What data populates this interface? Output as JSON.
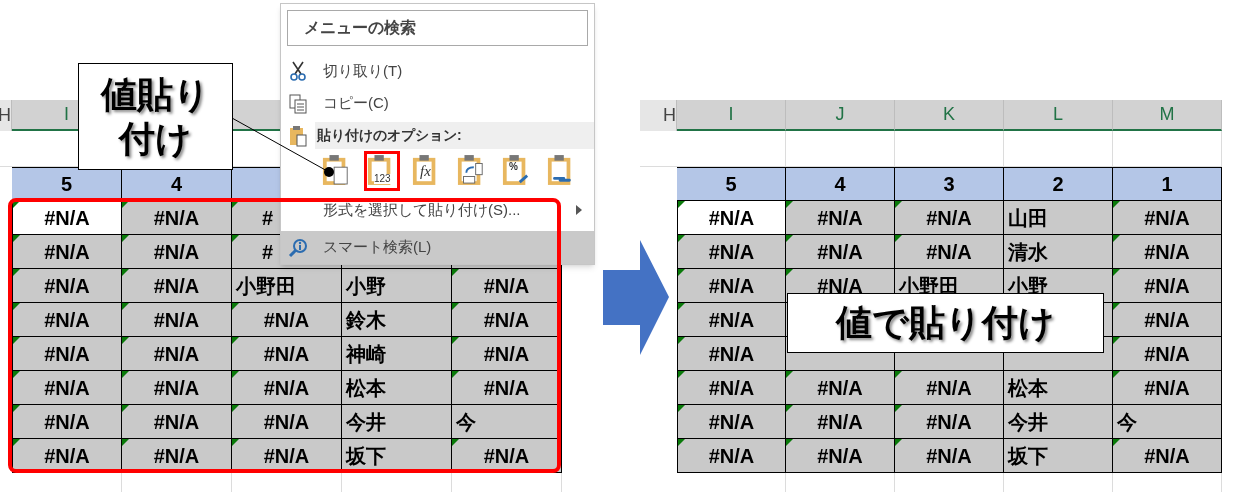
{
  "left_sheet": {
    "row_stub": "H",
    "columns": [
      "I"
    ],
    "numbers": [
      "5",
      "4"
    ],
    "rows": [
      [
        {
          "kind": "error",
          "text": "#N/A",
          "selected": true
        },
        {
          "kind": "error",
          "text": "#N/A",
          "selected": false
        },
        {
          "kind": "clipped",
          "text": "#",
          "selected": false
        }
      ],
      [
        {
          "kind": "error",
          "text": "#N/A",
          "selected": false
        },
        {
          "kind": "error",
          "text": "#N/A",
          "selected": false
        },
        {
          "kind": "clipped",
          "text": "#",
          "selected": false
        }
      ],
      [
        {
          "kind": "error",
          "text": "#N/A",
          "selected": false
        },
        {
          "kind": "error",
          "text": "#N/A",
          "selected": false
        },
        {
          "kind": "name",
          "text": "小野田",
          "selected": false
        },
        {
          "kind": "name",
          "text": "小野",
          "selected": false
        },
        {
          "kind": "error",
          "text": "#N/A",
          "selected": false
        }
      ],
      [
        {
          "kind": "error",
          "text": "#N/A",
          "selected": false
        },
        {
          "kind": "error",
          "text": "#N/A",
          "selected": false
        },
        {
          "kind": "error",
          "text": "#N/A",
          "selected": false
        },
        {
          "kind": "name",
          "text": "鈴木",
          "selected": false
        },
        {
          "kind": "error",
          "text": "#N/A",
          "selected": false
        }
      ],
      [
        {
          "kind": "error",
          "text": "#N/A",
          "selected": false
        },
        {
          "kind": "error",
          "text": "#N/A",
          "selected": false
        },
        {
          "kind": "error",
          "text": "#N/A",
          "selected": false
        },
        {
          "kind": "name",
          "text": "神崎",
          "selected": false
        },
        {
          "kind": "error",
          "text": "#N/A",
          "selected": false
        }
      ],
      [
        {
          "kind": "error",
          "text": "#N/A",
          "selected": false
        },
        {
          "kind": "error",
          "text": "#N/A",
          "selected": false
        },
        {
          "kind": "error",
          "text": "#N/A",
          "selected": false
        },
        {
          "kind": "name",
          "text": "松本",
          "selected": false
        },
        {
          "kind": "error",
          "text": "#N/A",
          "selected": false
        }
      ],
      [
        {
          "kind": "error",
          "text": "#N/A",
          "selected": false
        },
        {
          "kind": "error",
          "text": "#N/A",
          "selected": false
        },
        {
          "kind": "error",
          "text": "#N/A",
          "selected": false
        },
        {
          "kind": "name",
          "text": "今井",
          "selected": false
        },
        {
          "kind": "name",
          "text": "今",
          "selected": false
        }
      ],
      [
        {
          "kind": "error",
          "text": "#N/A",
          "selected": false
        },
        {
          "kind": "error",
          "text": "#N/A",
          "selected": false
        },
        {
          "kind": "error",
          "text": "#N/A",
          "selected": false
        },
        {
          "kind": "name",
          "text": "坂下",
          "selected": false
        },
        {
          "kind": "error",
          "text": "#N/A",
          "selected": false
        }
      ]
    ]
  },
  "context_menu": {
    "search_placeholder": "メニューの検索",
    "items": [
      {
        "kind": "cut",
        "label": "切り取り(T)",
        "highlighted": false
      },
      {
        "kind": "copy",
        "label": "コピー(C)",
        "highlighted": false
      },
      {
        "kind": "paste_header",
        "label": "貼り付けのオプション:"
      },
      {
        "kind": "paste_options",
        "options": [
          {
            "kind": "paste",
            "selected": false
          },
          {
            "kind": "values",
            "label": "123",
            "selected": true
          },
          {
            "kind": "formulas",
            "label": "fx",
            "selected": false
          },
          {
            "kind": "transpose",
            "selected": false
          },
          {
            "kind": "formatting",
            "label": "%",
            "selected": false
          },
          {
            "kind": "link",
            "selected": false
          }
        ]
      },
      {
        "kind": "paste_special",
        "label": "形式を選択して貼り付け(S)...",
        "highlighted": false
      },
      {
        "kind": "smart_lookup",
        "label": "スマート検索(L)",
        "highlighted": true
      }
    ]
  },
  "callout_left": {
    "lines": [
      "値貼り",
      "付け"
    ]
  },
  "right_sheet": {
    "row_stub": "H",
    "columns": [
      "I",
      "J",
      "K",
      "L",
      "M"
    ],
    "numbers": [
      "5",
      "4",
      "3",
      "2",
      "1"
    ],
    "rows": [
      [
        {
          "kind": "error",
          "text": "#N/A",
          "selected": true
        },
        {
          "kind": "error",
          "text": "#N/A",
          "selected": false
        },
        {
          "kind": "error",
          "text": "#N/A",
          "selected": false
        },
        {
          "kind": "name",
          "text": "山田",
          "selected": false
        },
        {
          "kind": "error",
          "text": "#N/A",
          "selected": false
        }
      ],
      [
        {
          "kind": "error",
          "text": "#N/A",
          "selected": false
        },
        {
          "kind": "error",
          "text": "#N/A",
          "selected": false
        },
        {
          "kind": "error",
          "text": "#N/A",
          "selected": false
        },
        {
          "kind": "name",
          "text": "清水",
          "selected": false
        },
        {
          "kind": "error",
          "text": "#N/A",
          "selected": false
        }
      ],
      [
        {
          "kind": "error",
          "text": "#N/A",
          "selected": false
        },
        {
          "kind": "error",
          "text": "#N/A",
          "selected": false
        },
        {
          "kind": "name",
          "text": "小野田",
          "selected": false
        },
        {
          "kind": "name",
          "text": "小野",
          "selected": false
        },
        {
          "kind": "error",
          "text": "#N/A",
          "selected": false
        }
      ],
      [
        {
          "kind": "error",
          "text": "#N/A",
          "selected": false
        },
        {
          "kind": "covered"
        },
        {
          "kind": "covered"
        },
        {
          "kind": "covered"
        },
        {
          "kind": "error",
          "text": "#N/A",
          "selected": false
        }
      ],
      [
        {
          "kind": "error",
          "text": "#N/A",
          "selected": false
        },
        {
          "kind": "covered"
        },
        {
          "kind": "covered"
        },
        {
          "kind": "covered"
        },
        {
          "kind": "error",
          "text": "#N/A",
          "selected": false
        }
      ],
      [
        {
          "kind": "error",
          "text": "#N/A",
          "selected": false
        },
        {
          "kind": "error",
          "text": "#N/A",
          "selected": false
        },
        {
          "kind": "error",
          "text": "#N/A",
          "selected": false
        },
        {
          "kind": "name",
          "text": "松本",
          "selected": false
        },
        {
          "kind": "error",
          "text": "#N/A",
          "selected": false
        }
      ],
      [
        {
          "kind": "error",
          "text": "#N/A",
          "selected": false
        },
        {
          "kind": "error",
          "text": "#N/A",
          "selected": false
        },
        {
          "kind": "error",
          "text": "#N/A",
          "selected": false
        },
        {
          "kind": "name",
          "text": "今井",
          "selected": false
        },
        {
          "kind": "name",
          "text": "今",
          "selected": false
        }
      ],
      [
        {
          "kind": "error",
          "text": "#N/A",
          "selected": false
        },
        {
          "kind": "error",
          "text": "#N/A",
          "selected": false
        },
        {
          "kind": "error",
          "text": "#N/A",
          "selected": false
        },
        {
          "kind": "name",
          "text": "坂下",
          "selected": false
        },
        {
          "kind": "error",
          "text": "#N/A",
          "selected": false
        }
      ]
    ]
  },
  "callout_right": {
    "text": "値で貼り付け"
  }
}
